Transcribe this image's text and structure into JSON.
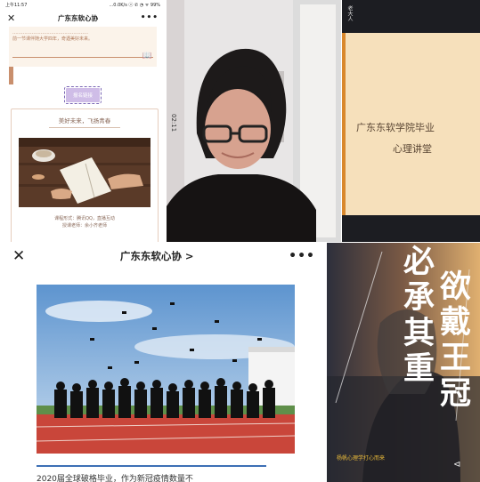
{
  "panel1": {
    "status_left": "上午11:57",
    "status_right": "...0.0K/s ⓥ ✆ ◔ ᯤ 99%",
    "nav_close": "✕",
    "nav_title": "广东东软心协",
    "nav_more": "•••",
    "top_text": "……………………………………………\n前一节课伴随大学四年，奇遇美好未来。",
    "button_label": "报名链接",
    "slogan": "美好未来，飞扬青春",
    "course_form": "课程形式：腾讯QQ，直播互动",
    "teacher": "授课老师：余小齐老师"
  },
  "panel2": {
    "time_label": "02:11"
  },
  "panel3": {
    "side_label": "老大人",
    "slide_line1": "广东东软学院毕业",
    "slide_line2": "心理讲堂"
  },
  "panel4": {
    "nav_close": "✕",
    "nav_title": "广东东软心协 >",
    "nav_more": "•••",
    "caption": "2020届全球破格毕业，作为新冠疫情数量不"
  },
  "panel5": {
    "col1": [
      "必",
      "承",
      "其",
      "重"
    ],
    "col2": [
      "欲",
      "戴",
      "王",
      "冠"
    ],
    "footer": "杨帆心理学打心而来",
    "plane_icon": "⊲"
  },
  "colors": {
    "accent_brown": "#c98f6d",
    "button_purple": "#cfbde7",
    "slide_bg": "#f6e0bb",
    "slide_border": "#d9882c",
    "progress_blue": "#3d6fb5"
  }
}
